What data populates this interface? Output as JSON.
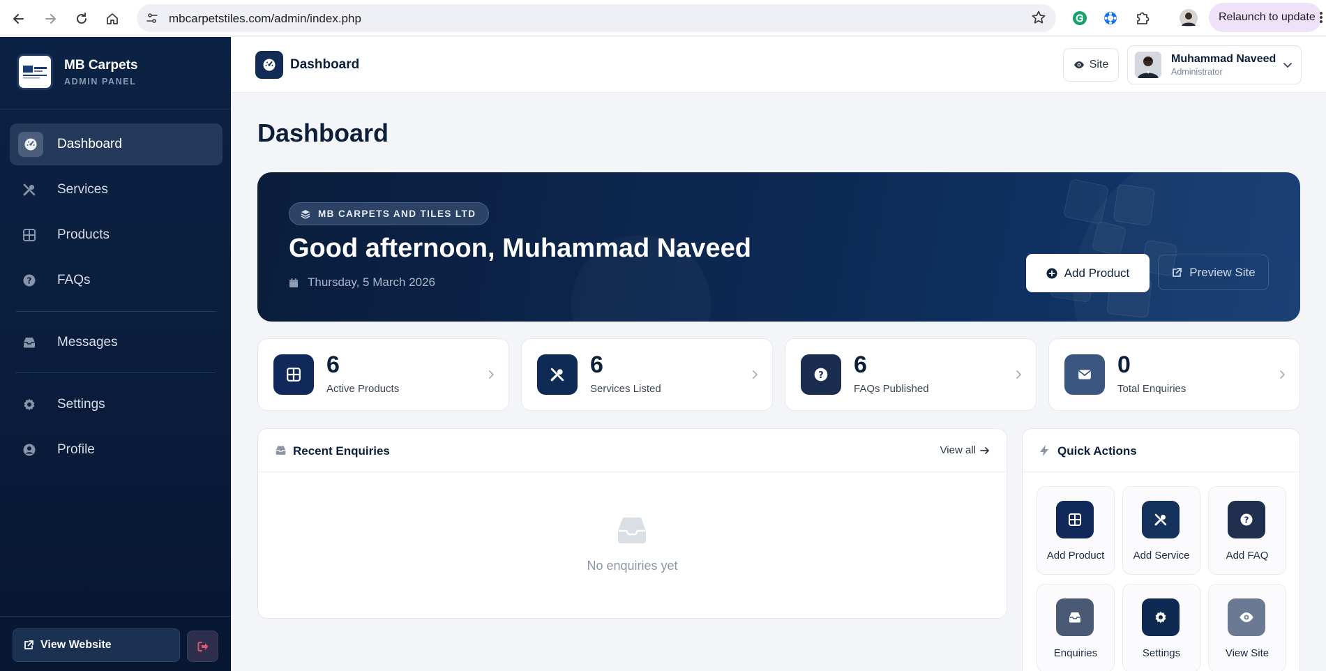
{
  "browser": {
    "url": "mbcarpetstiles.com/admin/index.php",
    "relaunch_label": "Relaunch to update"
  },
  "brand": {
    "name": "MB Carpets",
    "subtitle": "ADMIN PANEL"
  },
  "sidebar": {
    "items": [
      {
        "label": "Dashboard",
        "icon": "gauge-icon",
        "active": true
      },
      {
        "label": "Services",
        "icon": "tools-icon"
      },
      {
        "label": "Products",
        "icon": "grid-icon"
      },
      {
        "label": "FAQs",
        "icon": "question-icon"
      },
      {
        "label": "Messages",
        "icon": "inbox-icon"
      },
      {
        "label": "Settings",
        "icon": "gear-icon"
      },
      {
        "label": "Profile",
        "icon": "user-icon"
      }
    ],
    "view_website": "View Website"
  },
  "topbar": {
    "title": "Dashboard",
    "site_label": "Site",
    "user_name": "Muhammad Naveed",
    "user_role": "Administrator"
  },
  "page": {
    "title": "Dashboard"
  },
  "hero": {
    "company": "MB CARPETS AND TILES LTD",
    "greeting": "Good afternoon, Muhammad Naveed",
    "date": "Thursday, 5 March 2026",
    "add_product": "Add Product",
    "preview_site": "Preview Site"
  },
  "stats": [
    {
      "value": "6",
      "label": "Active Products",
      "icon": "grid-icon",
      "color": "#10285a"
    },
    {
      "value": "6",
      "label": "Services Listed",
      "icon": "tools-icon",
      "color": "#0f2b55"
    },
    {
      "value": "6",
      "label": "FAQs Published",
      "icon": "question-icon",
      "color": "#1a2d50"
    },
    {
      "value": "0",
      "label": "Total Enquiries",
      "icon": "envelope-icon",
      "color": "#3b5680"
    }
  ],
  "enquiries": {
    "title": "Recent Enquiries",
    "view_all": "View all",
    "empty": "No enquiries yet"
  },
  "quick_actions": {
    "title": "Quick Actions",
    "items": [
      {
        "label": "Add Product",
        "icon": "grid-icon",
        "color": "#10285a"
      },
      {
        "label": "Add Service",
        "icon": "tools-icon",
        "color": "#15325c"
      },
      {
        "label": "Add FAQ",
        "icon": "question-icon",
        "color": "#1f2f4d"
      },
      {
        "label": "Enquiries",
        "icon": "inbox-icon",
        "color": "#4a5a75"
      },
      {
        "label": "Settings",
        "icon": "gear-icon",
        "color": "#0f2a52"
      },
      {
        "label": "View Site",
        "icon": "eye-icon",
        "color": "#6b7a92"
      }
    ]
  }
}
